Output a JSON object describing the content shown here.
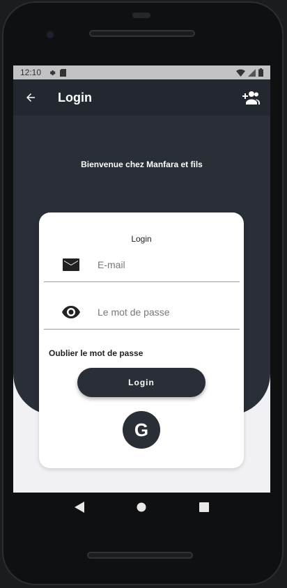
{
  "status_bar": {
    "time": "12:10",
    "icons": [
      "gear-icon",
      "sd-card-icon",
      "wifi-icon",
      "signal-icon",
      "battery-icon"
    ]
  },
  "app_bar": {
    "title": "Login",
    "back_icon": "arrow-left-icon",
    "action_icon": "add-user-icon",
    "background": "#23272f"
  },
  "welcome_text": "Bienvenue chez Manfara et fils",
  "login_card": {
    "title": "Login",
    "email": {
      "placeholder": "E-mail",
      "value": "",
      "icon": "mail-icon"
    },
    "password": {
      "placeholder": "Le mot de passe",
      "value": "",
      "icon": "eye-icon"
    },
    "forgot_password": "Oublier le mot de passe",
    "login_button": "Login",
    "google_button": "G"
  },
  "colors": {
    "primary_dark": "#2a2e36",
    "screen_background": "#f1f1f5",
    "card": "#ffffff"
  },
  "nav_bar": {
    "buttons": [
      "back-triangle-icon",
      "home-circle-icon",
      "recents-square-icon"
    ]
  }
}
